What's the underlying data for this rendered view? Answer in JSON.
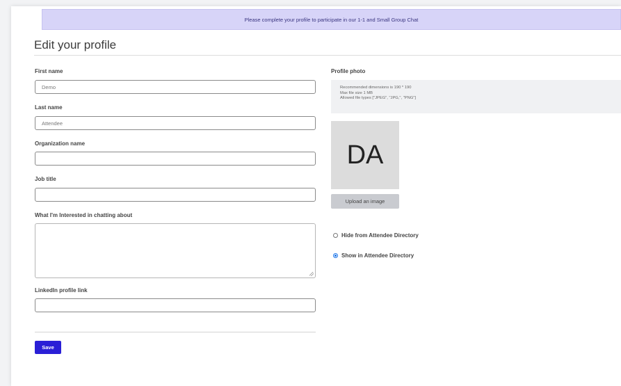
{
  "banner": {
    "text": "Please complete your profile to participate in our 1-1 and Small Group Chat"
  },
  "page": {
    "title": "Edit your profile"
  },
  "form": {
    "first_name": {
      "label": "First name",
      "value": "Demo"
    },
    "last_name": {
      "label": "Last name",
      "value": "Attendee"
    },
    "organization": {
      "label": "Organization name",
      "value": ""
    },
    "job_title": {
      "label": "Job title",
      "value": ""
    },
    "interests": {
      "label": "What I'm Interested in chatting about",
      "value": ""
    },
    "linkedin": {
      "label": "LinkedIn profile link",
      "value": ""
    },
    "save_label": "Save"
  },
  "photo": {
    "label": "Profile photo",
    "info_lines": [
      "Recommended dimensions is 190 * 190",
      "Max file size 1 MB",
      "Allowed file types [\"JPEG\", \"JPG,\", \"PNG\"]"
    ],
    "initials": "DA",
    "upload_label": "Upload an image"
  },
  "directory": {
    "options": [
      {
        "label": "Hide from Attendee Directory",
        "checked": false
      },
      {
        "label": "Show in Attendee Directory",
        "checked": true
      }
    ]
  },
  "colors": {
    "accent": "#2a1fd6",
    "banner_bg": "#d7d4f8",
    "radio": "#1a73e8"
  }
}
